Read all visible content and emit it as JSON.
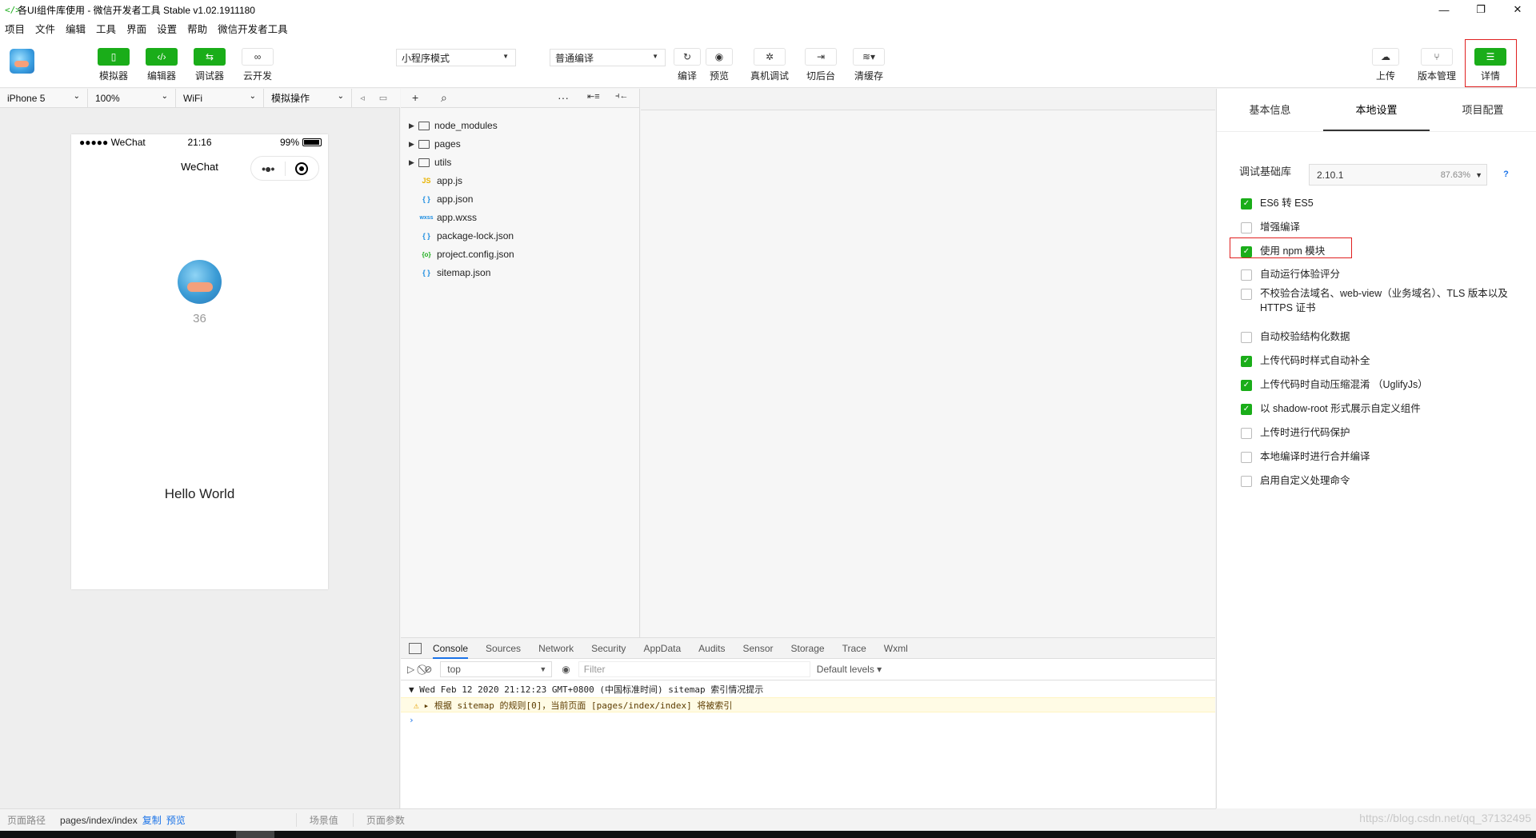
{
  "window": {
    "title": "各UI组件库使用 - 微信开发者工具 Stable v1.02.1911180",
    "controls": [
      "—",
      "❐",
      "✕"
    ]
  },
  "menu": [
    "项目",
    "文件",
    "编辑",
    "工具",
    "界面",
    "设置",
    "帮助",
    "微信开发者工具"
  ],
  "toolbar": {
    "left_buttons": [
      {
        "label": "模拟器",
        "icon": "phone-icon"
      },
      {
        "label": "编辑器",
        "icon": "code-icon"
      },
      {
        "label": "调试器",
        "icon": "debug-icon"
      },
      {
        "label": "云开发",
        "icon": "cloud-link-icon"
      }
    ],
    "mode_select": "小程序模式",
    "compile_select": "普通编译",
    "mid_buttons": [
      {
        "label": "编译",
        "icon": "refresh-icon"
      },
      {
        "label": "预览",
        "icon": "eye-icon"
      },
      {
        "label": "真机调试",
        "icon": "bug-icon"
      },
      {
        "label": "切后台",
        "icon": "switch-icon"
      },
      {
        "label": "清缓存",
        "icon": "layers-icon"
      }
    ],
    "right_buttons": [
      {
        "label": "上传",
        "icon": "upload-cloud-icon"
      },
      {
        "label": "版本管理",
        "icon": "branch-icon"
      },
      {
        "label": "详情",
        "icon": "menu-icon"
      }
    ]
  },
  "simbar": {
    "device": "iPhone 5",
    "zoom": "100%",
    "network": "WiFi",
    "operation": "模拟操作"
  },
  "phone": {
    "signal": "●●●●● WeChat",
    "time": "21:16",
    "battery": "99%",
    "nav_title": "WeChat",
    "counter": "36",
    "hello": "Hello World"
  },
  "filetree": [
    {
      "name": "node_modules",
      "type": "folder"
    },
    {
      "name": "pages",
      "type": "folder"
    },
    {
      "name": "utils",
      "type": "folder"
    },
    {
      "name": "app.js",
      "type": "js",
      "icon": "JS"
    },
    {
      "name": "app.json",
      "type": "json",
      "icon": "{ }"
    },
    {
      "name": "app.wxss",
      "type": "wxss",
      "icon": "wxss"
    },
    {
      "name": "package-lock.json",
      "type": "json",
      "icon": "{ }"
    },
    {
      "name": "project.config.json",
      "type": "cfg",
      "icon": "{o}"
    },
    {
      "name": "sitemap.json",
      "type": "json",
      "icon": "{ }"
    }
  ],
  "devtools": {
    "tabs": [
      "Console",
      "Sources",
      "Network",
      "Security",
      "AppData",
      "Audits",
      "Sensor",
      "Storage",
      "Trace",
      "Wxml"
    ],
    "active_tab": "Console",
    "context": "top",
    "filter_placeholder": "Filter",
    "levels": "Default levels ▾",
    "log_header": "Wed Feb 12 2020 21:12:23 GMT+0800 (中国标准时间) sitemap 索引情况提示",
    "log_warning": "根据 sitemap 的规则[0]，当前页面 [pages/index/index] 将被索引",
    "prompt": "›"
  },
  "rpanel": {
    "tabs": [
      "基本信息",
      "本地设置",
      "项目配置"
    ],
    "active_tab": "本地设置",
    "lib_label": "调试基础库",
    "lib_version": "2.10.1",
    "lib_percent": "87.63%",
    "help": "?",
    "options": [
      {
        "label": "ES6 转 ES5",
        "checked": true
      },
      {
        "label": "增强编译",
        "checked": false
      },
      {
        "label": "使用 npm 模块",
        "checked": true
      },
      {
        "label": "自动运行体验评分",
        "checked": false
      },
      {
        "label": "不校验合法域名、web-view（业务域名）、TLS 版本以及 HTTPS 证书",
        "checked": false
      },
      {
        "label": "自动校验结构化数据",
        "checked": false
      },
      {
        "label": "上传代码时样式自动补全",
        "checked": true
      },
      {
        "label": "上传代码时自动压缩混淆 （UglifyJs）",
        "checked": true
      },
      {
        "label": "以 shadow-root 形式展示自定义组件",
        "checked": true
      },
      {
        "label": "上传时进行代码保护",
        "checked": false
      },
      {
        "label": "本地编译时进行合并编译",
        "checked": false
      },
      {
        "label": "启用自定义处理命令",
        "checked": false
      }
    ]
  },
  "status": {
    "path_label": "页面路径",
    "path": "pages/index/index",
    "copy": "复制",
    "preview": "预览",
    "scene": "场景值",
    "params": "页面参数"
  },
  "watermark": "https://blog.csdn.net/qq_37132495",
  "colors": {
    "accent": "#1aad19",
    "highlight": "#e02020",
    "link": "#1a73e8"
  }
}
